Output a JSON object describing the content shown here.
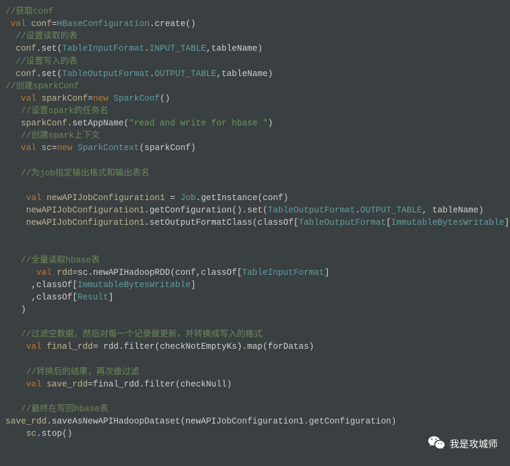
{
  "code": {
    "lines": [
      [
        {
          "c": "cmt",
          "t": "//获取conf"
        }
      ],
      [
        {
          "c": "plain",
          "t": " "
        },
        {
          "c": "kw",
          "t": "val"
        },
        {
          "c": "plain",
          "t": " "
        },
        {
          "c": "id",
          "t": "conf"
        },
        {
          "c": "plain",
          "t": "="
        },
        {
          "c": "type",
          "t": "HBaseConfiguration"
        },
        {
          "c": "plain",
          "t": ".create()"
        }
      ],
      [
        {
          "c": "plain",
          "t": "  "
        },
        {
          "c": "cmt",
          "t": "//设置读取的表"
        }
      ],
      [
        {
          "c": "plain",
          "t": "  "
        },
        {
          "c": "id",
          "t": "conf"
        },
        {
          "c": "plain",
          "t": ".set("
        },
        {
          "c": "type",
          "t": "TableInputFormat"
        },
        {
          "c": "plain",
          "t": "."
        },
        {
          "c": "type",
          "t": "INPUT_TABLE"
        },
        {
          "c": "plain",
          "t": ",tableName)"
        }
      ],
      [
        {
          "c": "plain",
          "t": "  "
        },
        {
          "c": "cmt",
          "t": "//设置写入的表"
        }
      ],
      [
        {
          "c": "plain",
          "t": "  "
        },
        {
          "c": "id",
          "t": "conf"
        },
        {
          "c": "plain",
          "t": ".set("
        },
        {
          "c": "type",
          "t": "TableOutputFormat"
        },
        {
          "c": "plain",
          "t": "."
        },
        {
          "c": "type",
          "t": "OUTPUT_TABLE"
        },
        {
          "c": "plain",
          "t": ",tableName)"
        }
      ],
      [
        {
          "c": "cmt",
          "t": "//创建sparkConf"
        }
      ],
      [
        {
          "c": "plain",
          "t": "   "
        },
        {
          "c": "kw",
          "t": "val"
        },
        {
          "c": "plain",
          "t": " "
        },
        {
          "c": "id",
          "t": "sparkConf"
        },
        {
          "c": "plain",
          "t": "="
        },
        {
          "c": "kw",
          "t": "new"
        },
        {
          "c": "plain",
          "t": " "
        },
        {
          "c": "type",
          "t": "SparkConf"
        },
        {
          "c": "plain",
          "t": "()"
        }
      ],
      [
        {
          "c": "plain",
          "t": "   "
        },
        {
          "c": "cmt",
          "t": "//设置spark的任务名"
        }
      ],
      [
        {
          "c": "plain",
          "t": "   "
        },
        {
          "c": "id",
          "t": "sparkConf"
        },
        {
          "c": "plain",
          "t": ".setAppName("
        },
        {
          "c": "str",
          "t": "\"read and write for hbase \""
        },
        {
          "c": "plain",
          "t": ")"
        }
      ],
      [
        {
          "c": "plain",
          "t": "   "
        },
        {
          "c": "cmt",
          "t": "//创建spark上下文"
        }
      ],
      [
        {
          "c": "plain",
          "t": "   "
        },
        {
          "c": "kw",
          "t": "val"
        },
        {
          "c": "plain",
          "t": " "
        },
        {
          "c": "id",
          "t": "sc"
        },
        {
          "c": "plain",
          "t": "="
        },
        {
          "c": "kw",
          "t": "new"
        },
        {
          "c": "plain",
          "t": " "
        },
        {
          "c": "type",
          "t": "SparkContext"
        },
        {
          "c": "plain",
          "t": "(sparkConf)"
        }
      ],
      [
        {
          "c": "plain",
          "t": " "
        }
      ],
      [
        {
          "c": "plain",
          "t": "   "
        },
        {
          "c": "cmt",
          "t": "//为job指定输出格式和输出表名"
        }
      ],
      [
        {
          "c": "plain",
          "t": " "
        }
      ],
      [
        {
          "c": "plain",
          "t": "    "
        },
        {
          "c": "kw",
          "t": "val"
        },
        {
          "c": "plain",
          "t": " "
        },
        {
          "c": "id",
          "t": "newAPIJobConfiguration1"
        },
        {
          "c": "plain",
          "t": " = "
        },
        {
          "c": "type",
          "t": "Job"
        },
        {
          "c": "plain",
          "t": ".getInstance(conf)"
        }
      ],
      [
        {
          "c": "plain",
          "t": "    "
        },
        {
          "c": "id",
          "t": "newAPIJobConfiguration1"
        },
        {
          "c": "plain",
          "t": ".getConfiguration().set("
        },
        {
          "c": "type",
          "t": "TableOutputFormat"
        },
        {
          "c": "plain",
          "t": "."
        },
        {
          "c": "type",
          "t": "OUTPUT_TABLE"
        },
        {
          "c": "plain",
          "t": ", tableName)"
        }
      ],
      [
        {
          "c": "plain",
          "t": "    "
        },
        {
          "c": "id",
          "t": "newAPIJobConfiguration1"
        },
        {
          "c": "plain",
          "t": ".setOutputFormatClass(classOf["
        },
        {
          "c": "type",
          "t": "TableOutputFormat"
        },
        {
          "c": "plain",
          "t": "["
        },
        {
          "c": "type",
          "t": "ImmutableBytesWritable"
        },
        {
          "c": "plain",
          "t": "]])"
        }
      ],
      [
        {
          "c": "plain",
          "t": " "
        }
      ],
      [
        {
          "c": "plain",
          "t": " "
        }
      ],
      [
        {
          "c": "plain",
          "t": "   "
        },
        {
          "c": "cmt",
          "t": "//全量读取hbase表"
        }
      ],
      [
        {
          "c": "plain",
          "t": "      "
        },
        {
          "c": "kw",
          "t": "val"
        },
        {
          "c": "plain",
          "t": " "
        },
        {
          "c": "id",
          "t": "rdd"
        },
        {
          "c": "plain",
          "t": "=sc.newAPIHadoopRDD(conf,classOf["
        },
        {
          "c": "type",
          "t": "TableInputFormat"
        },
        {
          "c": "plain",
          "t": "]"
        }
      ],
      [
        {
          "c": "plain",
          "t": "     ,classOf["
        },
        {
          "c": "type",
          "t": "ImmutableBytesWritable"
        },
        {
          "c": "plain",
          "t": "]"
        }
      ],
      [
        {
          "c": "plain",
          "t": "     ,classOf["
        },
        {
          "c": "type",
          "t": "Result"
        },
        {
          "c": "plain",
          "t": "]"
        }
      ],
      [
        {
          "c": "plain",
          "t": "   )"
        }
      ],
      [
        {
          "c": "plain",
          "t": " "
        }
      ],
      [
        {
          "c": "plain",
          "t": "   "
        },
        {
          "c": "cmt",
          "t": "//过滤空数据，然后对每一个记录做更新，并转换成写入的格式"
        }
      ],
      [
        {
          "c": "plain",
          "t": "    "
        },
        {
          "c": "kw",
          "t": "val"
        },
        {
          "c": "plain",
          "t": " "
        },
        {
          "c": "id",
          "t": "final_rdd"
        },
        {
          "c": "plain",
          "t": "= rdd.filter(checkNotEmptyKs).map(forDatas)"
        }
      ],
      [
        {
          "c": "plain",
          "t": " "
        }
      ],
      [
        {
          "c": "plain",
          "t": "    "
        },
        {
          "c": "cmt",
          "t": "//转换后的结果，再次做过滤"
        }
      ],
      [
        {
          "c": "plain",
          "t": "    "
        },
        {
          "c": "kw",
          "t": "val"
        },
        {
          "c": "plain",
          "t": " "
        },
        {
          "c": "id",
          "t": "save_rdd"
        },
        {
          "c": "plain",
          "t": "=final_rdd.filter(checkNull)"
        }
      ],
      [
        {
          "c": "plain",
          "t": " "
        }
      ],
      [
        {
          "c": "plain",
          "t": "   "
        },
        {
          "c": "cmt",
          "t": "//最终在写回hbase表"
        }
      ],
      [
        {
          "c": "id",
          "t": "save_rdd"
        },
        {
          "c": "plain",
          "t": ".saveAsNewAPIHadoopDataset(newAPIJobConfiguration1.getConfiguration)"
        }
      ],
      [
        {
          "c": "plain",
          "t": "    "
        },
        {
          "c": "id",
          "t": "sc"
        },
        {
          "c": "plain",
          "t": ".stop()"
        }
      ]
    ]
  },
  "watermark": {
    "text": "我是攻城师"
  }
}
